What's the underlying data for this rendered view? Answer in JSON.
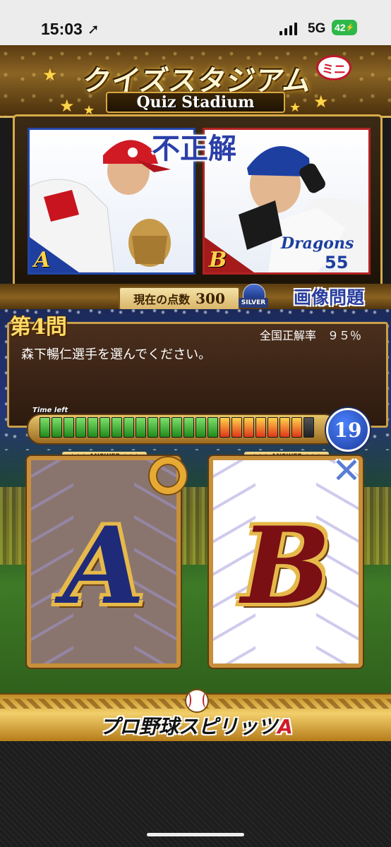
{
  "status_bar": {
    "time": "15:03",
    "network": "5G",
    "battery": "42"
  },
  "header": {
    "title_jp": "クイズスタジアム",
    "mini_badge": "ミニ",
    "title_en": "Quiz Stadium"
  },
  "photos": {
    "result": "不正解",
    "option_a_label": "A",
    "option_b_label": "B"
  },
  "score": {
    "label": "現在の点数",
    "value": "300",
    "rank_badge": "SILVER",
    "category": "画像問題"
  },
  "question": {
    "number_label": "第4問",
    "national_rate_label": "全国正解率　９５％",
    "text": "森下暢仁選手を選んでください。"
  },
  "timer": {
    "label": "Time left",
    "seconds": "19",
    "green_segments": 15,
    "orange_segments": 7,
    "empty_segments": 1
  },
  "answers": {
    "tag": "★★★ ANSWER ★★★",
    "option_a": "A",
    "option_b": "B",
    "correct": "A",
    "incorrect": "B"
  },
  "footer": {
    "logo_text": "プロ野球スピリッツ",
    "logo_suffix": "A"
  },
  "colors": {
    "gold": "#d8aa4a",
    "team_a_border": "#2246a8",
    "team_b_border": "#b22222",
    "timer_badge": "#2b5bd6"
  }
}
